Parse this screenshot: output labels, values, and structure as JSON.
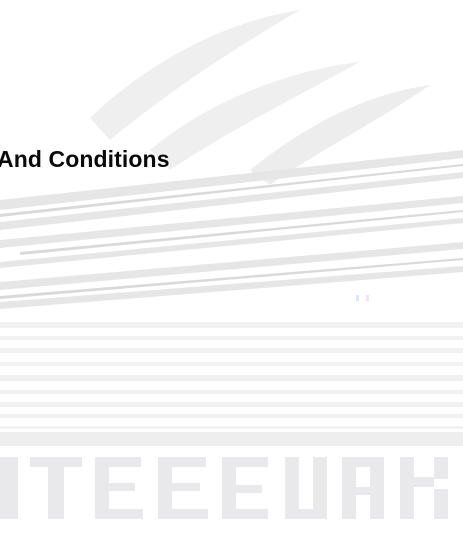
{
  "page": {
    "title": "And Conditions"
  },
  "watermark": {
    "icon": "stylized-swoosh-logo",
    "color": "#e9e9e9"
  },
  "colors": {
    "title": "#0a0a0a",
    "background": "#ffffff",
    "watermark": "#ebebeb"
  }
}
